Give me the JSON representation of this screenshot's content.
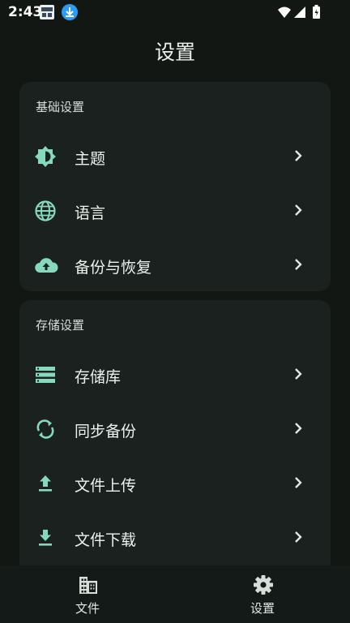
{
  "status_bar": {
    "time": "2:43"
  },
  "page": {
    "title": "设置"
  },
  "sections": [
    {
      "header": "基础设置",
      "items": [
        {
          "label": "主题",
          "icon": "brightness-icon"
        },
        {
          "label": "语言",
          "icon": "globe-icon"
        },
        {
          "label": "备份与恢复",
          "icon": "cloud-upload-icon"
        }
      ]
    },
    {
      "header": "存储设置",
      "items": [
        {
          "label": "存储库",
          "icon": "storage-icon"
        },
        {
          "label": "同步备份",
          "icon": "sync-icon"
        },
        {
          "label": "文件上传",
          "icon": "upload-icon"
        },
        {
          "label": "文件下载",
          "icon": "download-icon"
        }
      ]
    }
  ],
  "bottom_nav": {
    "items": [
      {
        "label": "文件",
        "icon": "building-icon"
      },
      {
        "label": "设置",
        "icon": "gear-icon"
      }
    ]
  },
  "colors": {
    "background": "#121714",
    "card": "#1b211e",
    "accent": "#86d9bd",
    "text": "#eef2ef"
  }
}
